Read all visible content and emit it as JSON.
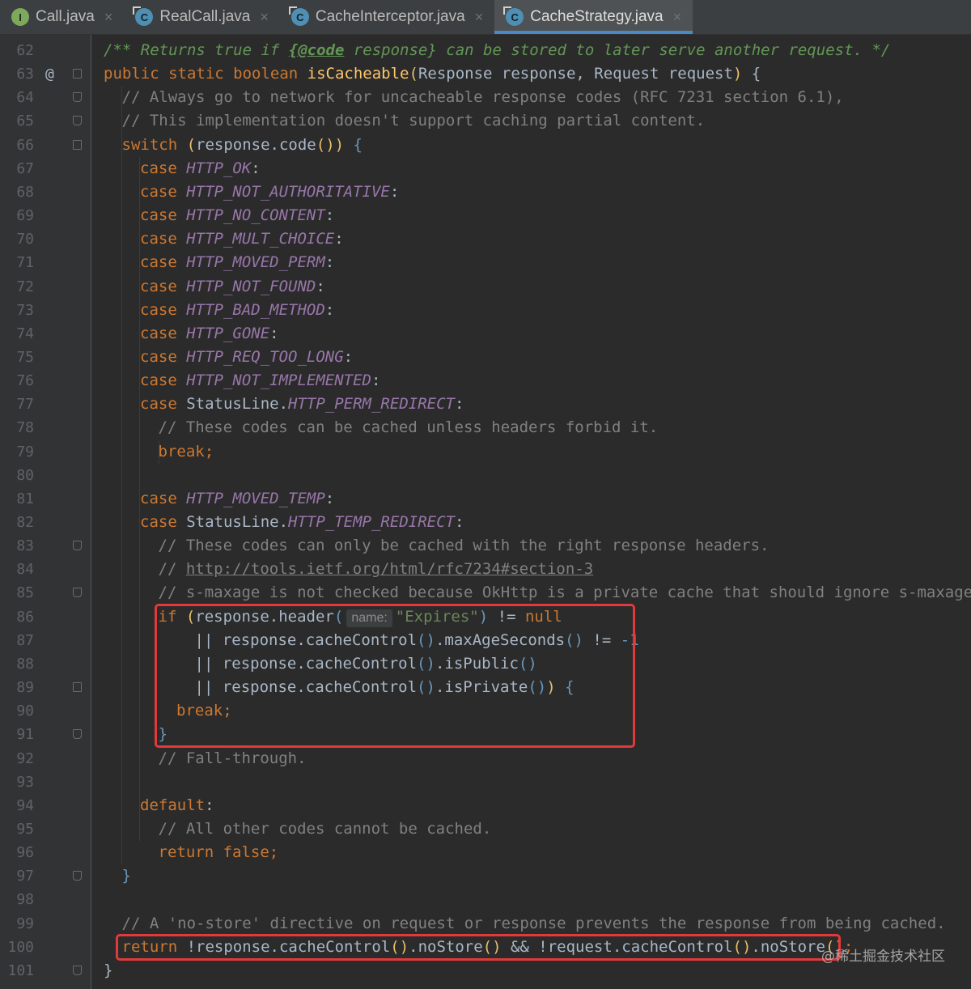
{
  "tabs": [
    {
      "label": "Call.java",
      "icon": "interface-icon",
      "active": false
    },
    {
      "label": "RealCall.java",
      "icon": "class-icon",
      "active": false
    },
    {
      "label": "CacheInterceptor.java",
      "icon": "class-icon",
      "active": false
    },
    {
      "label": "CacheStrategy.java",
      "icon": "class-icon",
      "active": true
    }
  ],
  "close_glyph": "×",
  "gutter": {
    "annotation_marker": "@"
  },
  "lines": [
    {
      "n": "62",
      "indent": 0,
      "segs": [
        [
          "doc",
          "/** Returns true if "
        ],
        [
          "doctag",
          "{@code"
        ],
        [
          "doc",
          " response} can be stored to later serve another request. */"
        ]
      ]
    },
    {
      "n": "63",
      "indent": 0,
      "segs": [
        [
          "kw",
          "public static boolean "
        ],
        [
          "fn",
          "isCacheable"
        ],
        [
          "par",
          "("
        ],
        [
          "p",
          "Response response, Request request"
        ],
        [
          "par",
          ")"
        ],
        [
          "p",
          " {"
        ]
      ]
    },
    {
      "n": "64",
      "indent": 1,
      "segs": [
        [
          "cmt",
          "// Always go to network for uncacheable response codes (RFC 7231 section 6.1),"
        ]
      ]
    },
    {
      "n": "65",
      "indent": 1,
      "segs": [
        [
          "cmt",
          "// This implementation doesn't support caching partial content."
        ]
      ]
    },
    {
      "n": "66",
      "indent": 1,
      "segs": [
        [
          "kw",
          "switch "
        ],
        [
          "par",
          "("
        ],
        [
          "p",
          "response.code"
        ],
        [
          "par",
          "()"
        ],
        [
          "par",
          ")"
        ],
        [
          "p",
          " "
        ],
        [
          "brc",
          "{"
        ]
      ]
    },
    {
      "n": "67",
      "indent": 2,
      "segs": [
        [
          "kw",
          "case "
        ],
        [
          "cst",
          "HTTP_OK"
        ],
        [
          "p",
          ":"
        ]
      ]
    },
    {
      "n": "68",
      "indent": 2,
      "segs": [
        [
          "kw",
          "case "
        ],
        [
          "cst",
          "HTTP_NOT_AUTHORITATIVE"
        ],
        [
          "p",
          ":"
        ]
      ]
    },
    {
      "n": "69",
      "indent": 2,
      "segs": [
        [
          "kw",
          "case "
        ],
        [
          "cst",
          "HTTP_NO_CONTENT"
        ],
        [
          "p",
          ":"
        ]
      ]
    },
    {
      "n": "70",
      "indent": 2,
      "segs": [
        [
          "kw",
          "case "
        ],
        [
          "cst",
          "HTTP_MULT_CHOICE"
        ],
        [
          "p",
          ":"
        ]
      ]
    },
    {
      "n": "71",
      "indent": 2,
      "segs": [
        [
          "kw",
          "case "
        ],
        [
          "cst",
          "HTTP_MOVED_PERM"
        ],
        [
          "p",
          ":"
        ]
      ]
    },
    {
      "n": "72",
      "indent": 2,
      "segs": [
        [
          "kw",
          "case "
        ],
        [
          "cst",
          "HTTP_NOT_FOUND"
        ],
        [
          "p",
          ":"
        ]
      ]
    },
    {
      "n": "73",
      "indent": 2,
      "segs": [
        [
          "kw",
          "case "
        ],
        [
          "cst",
          "HTTP_BAD_METHOD"
        ],
        [
          "p",
          ":"
        ]
      ]
    },
    {
      "n": "74",
      "indent": 2,
      "segs": [
        [
          "kw",
          "case "
        ],
        [
          "cst",
          "HTTP_GONE"
        ],
        [
          "p",
          ":"
        ]
      ]
    },
    {
      "n": "75",
      "indent": 2,
      "segs": [
        [
          "kw",
          "case "
        ],
        [
          "cst",
          "HTTP_REQ_TOO_LONG"
        ],
        [
          "p",
          ":"
        ]
      ]
    },
    {
      "n": "76",
      "indent": 2,
      "segs": [
        [
          "kw",
          "case "
        ],
        [
          "cst",
          "HTTP_NOT_IMPLEMENTED"
        ],
        [
          "p",
          ":"
        ]
      ]
    },
    {
      "n": "77",
      "indent": 2,
      "segs": [
        [
          "kw",
          "case "
        ],
        [
          "p",
          "StatusLine."
        ],
        [
          "cst",
          "HTTP_PERM_REDIRECT"
        ],
        [
          "p",
          ":"
        ]
      ]
    },
    {
      "n": "78",
      "indent": 3,
      "segs": [
        [
          "cmt",
          "// These codes can be cached unless headers forbid it."
        ]
      ]
    },
    {
      "n": "79",
      "indent": 3,
      "segs": [
        [
          "kw",
          "break;"
        ]
      ]
    },
    {
      "n": "80",
      "indent": 0,
      "segs": []
    },
    {
      "n": "81",
      "indent": 2,
      "segs": [
        [
          "kw",
          "case "
        ],
        [
          "cst",
          "HTTP_MOVED_TEMP"
        ],
        [
          "p",
          ":"
        ]
      ]
    },
    {
      "n": "82",
      "indent": 2,
      "segs": [
        [
          "kw",
          "case "
        ],
        [
          "p",
          "StatusLine."
        ],
        [
          "cst",
          "HTTP_TEMP_REDIRECT"
        ],
        [
          "p",
          ":"
        ]
      ]
    },
    {
      "n": "83",
      "indent": 3,
      "segs": [
        [
          "cmt",
          "// These codes can only be cached with the right response headers."
        ]
      ]
    },
    {
      "n": "84",
      "indent": 3,
      "segs": [
        [
          "cmt",
          "// "
        ],
        [
          "url",
          "http://tools.ietf.org/html/rfc7234#section-3"
        ]
      ]
    },
    {
      "n": "85",
      "indent": 3,
      "segs": [
        [
          "cmt",
          "// s-maxage is not checked because OkHttp is a private cache that should ignore s-maxage."
        ]
      ]
    },
    {
      "n": "86",
      "indent": 3,
      "segs": [
        [
          "kw",
          "if "
        ],
        [
          "par",
          "("
        ],
        [
          "p",
          "response.header"
        ],
        [
          "brc",
          "("
        ],
        [
          "hint",
          "name:"
        ],
        [
          "str",
          "\"Expires\""
        ],
        [
          "brc",
          ")"
        ],
        [
          "p",
          " != "
        ],
        [
          "kw",
          "null"
        ]
      ]
    },
    {
      "n": "87",
      "indent": 5,
      "segs": [
        [
          "p",
          "|| response.cacheControl"
        ],
        [
          "brc",
          "()"
        ],
        [
          "p",
          ".maxAgeSeconds"
        ],
        [
          "brc",
          "()"
        ],
        [
          "p",
          " != "
        ],
        [
          "num",
          "-1"
        ]
      ]
    },
    {
      "n": "88",
      "indent": 5,
      "segs": [
        [
          "p",
          "|| response.cacheControl"
        ],
        [
          "brc",
          "()"
        ],
        [
          "p",
          ".isPublic"
        ],
        [
          "brc",
          "()"
        ]
      ]
    },
    {
      "n": "89",
      "indent": 5,
      "segs": [
        [
          "p",
          "|| response.cacheControl"
        ],
        [
          "brc",
          "()"
        ],
        [
          "p",
          ".isPrivate"
        ],
        [
          "brc",
          "()"
        ],
        [
          "par",
          ")"
        ],
        [
          "p",
          " "
        ],
        [
          "brc",
          "{"
        ]
      ]
    },
    {
      "n": "90",
      "indent": 4,
      "segs": [
        [
          "kw",
          "break;"
        ]
      ]
    },
    {
      "n": "91",
      "indent": 3,
      "segs": [
        [
          "brc",
          "}"
        ]
      ]
    },
    {
      "n": "92",
      "indent": 3,
      "segs": [
        [
          "cmt",
          "// Fall-through."
        ]
      ]
    },
    {
      "n": "93",
      "indent": 0,
      "segs": []
    },
    {
      "n": "94",
      "indent": 2,
      "segs": [
        [
          "kw",
          "default"
        ],
        [
          "p",
          ":"
        ]
      ]
    },
    {
      "n": "95",
      "indent": 3,
      "segs": [
        [
          "cmt",
          "// All other codes cannot be cached."
        ]
      ]
    },
    {
      "n": "96",
      "indent": 3,
      "segs": [
        [
          "kw",
          "return false;"
        ]
      ]
    },
    {
      "n": "97",
      "indent": 1,
      "segs": [
        [
          "brc",
          "}"
        ]
      ]
    },
    {
      "n": "98",
      "indent": 0,
      "segs": []
    },
    {
      "n": "99",
      "indent": 1,
      "segs": [
        [
          "cmt",
          "// A 'no-store' directive on request or response prevents the response from being cached."
        ]
      ]
    },
    {
      "n": "100",
      "indent": 1,
      "segs": [
        [
          "kw",
          "return "
        ],
        [
          "p",
          "!response.cacheControl"
        ],
        [
          "par",
          "()"
        ],
        [
          "p",
          ".noStore"
        ],
        [
          "par",
          "()"
        ],
        [
          "p",
          " && !request.cacheControl"
        ],
        [
          "par",
          "()"
        ],
        [
          "p",
          ".noStore"
        ],
        [
          "par",
          "()"
        ],
        [
          "kw",
          ";"
        ]
      ]
    },
    {
      "n": "101",
      "indent": 0,
      "segs": [
        [
          "p",
          "}"
        ]
      ]
    }
  ],
  "highlight_color": "#e23a3a",
  "watermark": "@稀土掘金技术社区"
}
